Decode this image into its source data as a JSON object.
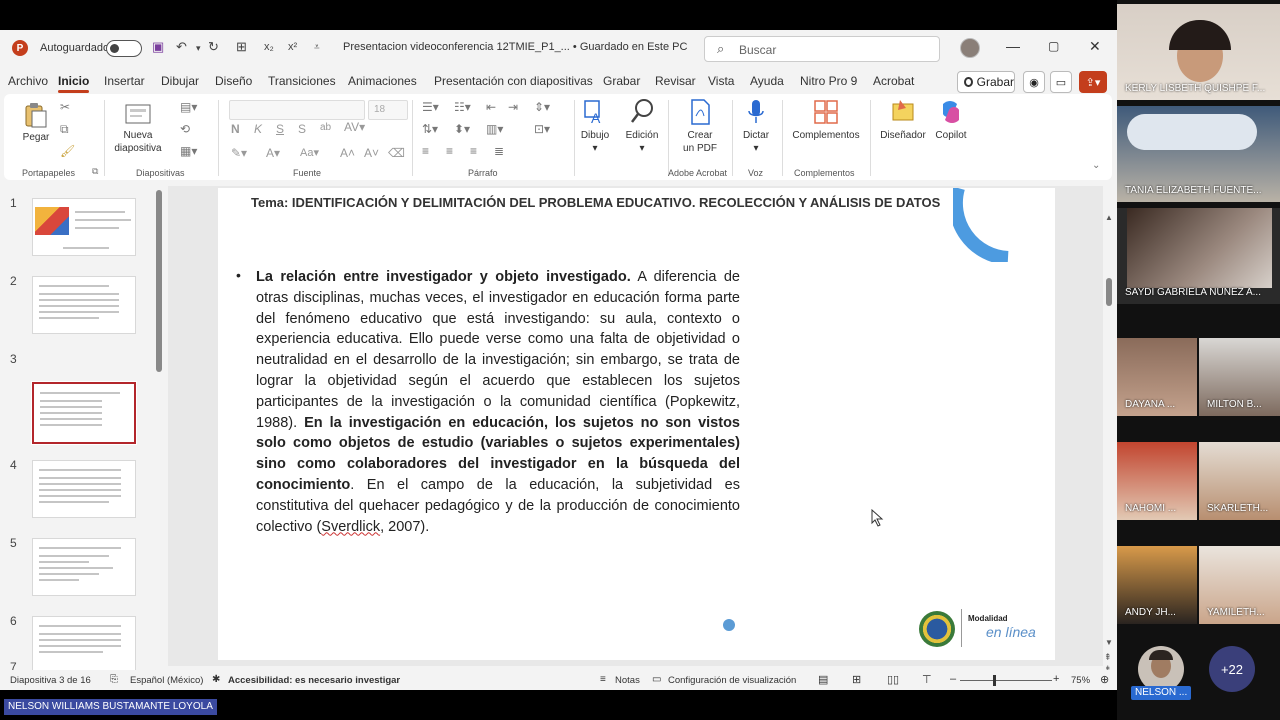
{
  "titlebar": {
    "autosave_label": "Autoguardado",
    "doc_title": "Presentacion videoconferencia 12TMIE_P1_... • Guardado en Este PC",
    "search_placeholder": "Buscar"
  },
  "ribbon_tabs": [
    "Archivo",
    "Inicio",
    "Insertar",
    "Dibujar",
    "Diseño",
    "Transiciones",
    "Animaciones",
    "Presentación con diapositivas",
    "Grabar",
    "Revisar",
    "Vista",
    "Ayuda",
    "Nitro Pro 9",
    "Acrobat"
  ],
  "active_tab": "Inicio",
  "grabar_label": "Grabar",
  "ribbon": {
    "pegar": "Pegar",
    "nueva": "Nueva",
    "diapositiva": "diapositiva",
    "font_size": "18",
    "dibujo": "Dibujo",
    "edicion": "Edición",
    "crear": "Crear",
    "un_pdf": "un PDF",
    "dictar": "Dictar",
    "complementos": "Complementos",
    "disenador": "Diseñador",
    "copilot": "Copilot",
    "groups": {
      "portapapeles": "Portapapeles",
      "diapositivas": "Diapositivas",
      "fuente": "Fuente",
      "parrafo": "Párrafo",
      "adobe": "Adobe Acrobat",
      "voz": "Voz",
      "complementos": "Complementos"
    }
  },
  "thumbnails": [
    "1",
    "2",
    "3",
    "4",
    "5",
    "6",
    "7"
  ],
  "selected_slide": 3,
  "slide": {
    "title": "Tema: IDENTIFICACIÓN Y DELIMITACIÓN DEL PROBLEMA EDUCATIVO. RECOLECCIÓN Y ANÁLISIS DE DATOS",
    "bullet": "•",
    "p1_bold": "La relación entre investigador y objeto investigado.",
    "p1_text": " A diferencia de otras disciplinas, muchas veces, el investigador en educación forma parte del fenómeno educativo que está investigando: su aula, contexto o experiencia educativa. Ello puede verse como una falta de objetividad o neutralidad en el desarrollo de la investigación; sin embargo, se trata de lograr la objetividad según el acuerdo que establecen los sujetos participantes de la investigación o la comunidad científica (Popkewitz, 1988). ",
    "p2_bold": "En la investigación en educación, los sujetos no son vistos solo como objetos de estudio (variables o sujetos experimentales) sino como colaboradores del investigador en la búsqueda del conocimiento",
    "p3_text": ". En el campo de la educación, la subjetividad es constitutiva del quehacer pedagógico y de la producción de conocimiento colectivo (",
    "p3_underlined": "Sverdlick",
    "p3_end": ", 2007).",
    "logo_modalidad": "Modalidad",
    "logo_linea": "en línea"
  },
  "status": {
    "slide_count": "Diapositiva 3 de 16",
    "language": "Español (México)",
    "accessibility": "Accesibilidad: es necesario investigar",
    "notes": "Notas",
    "display_settings": "Configuración de visualización",
    "zoom": "75%"
  },
  "participants": [
    {
      "name": "KERLY LISBETH QUISHPE F..."
    },
    {
      "name": "TANIA ELIZABETH FUENTE..."
    },
    {
      "name": "SAYDI GABRIELA NUNEZ A..."
    },
    {
      "name": "DAYANA ..."
    },
    {
      "name": "MILTON B..."
    },
    {
      "name": "NAHOMI ..."
    },
    {
      "name": "SKARLETH..."
    },
    {
      "name": "ANDY JH..."
    },
    {
      "name": "YAMILETH..."
    }
  ],
  "more_participants": "+22",
  "presenter_short": "NELSON ...",
  "presenter_full": "NELSON WILLIAMS BUSTAMANTE LOYOLA"
}
